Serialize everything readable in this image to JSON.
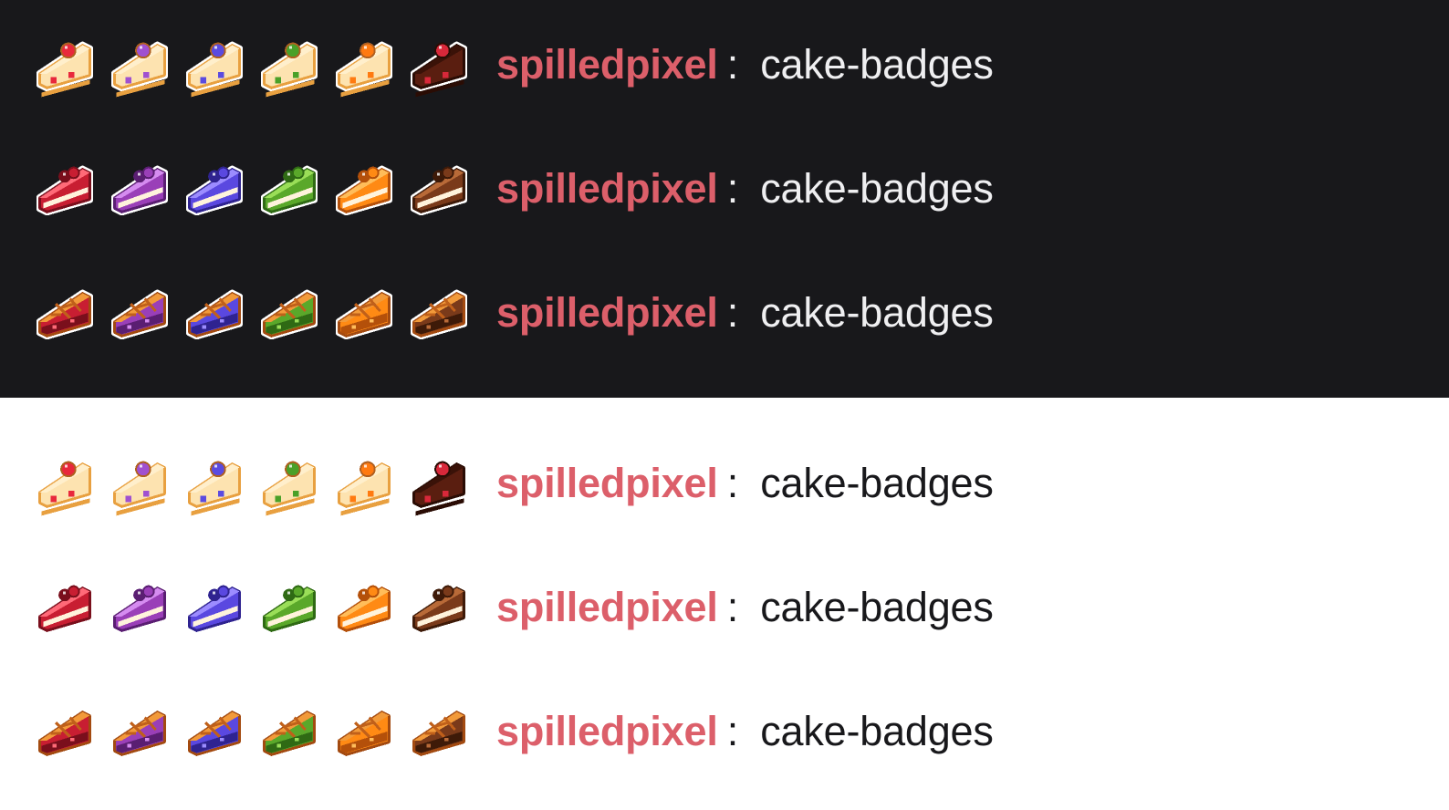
{
  "colors": {
    "dark_bg": "#18181b",
    "light_bg": "#ffffff",
    "username": "#dc5f6a"
  },
  "flavors": [
    {
      "name": "strawberry",
      "body": "#c81e32",
      "dark": "#7a0f1c",
      "light": "#ff6a78",
      "berry": "#e8283c"
    },
    {
      "name": "grape",
      "body": "#9a3fb8",
      "dark": "#5a1e72",
      "light": "#d58cf0",
      "berry": "#a050d0"
    },
    {
      "name": "blueberry",
      "body": "#5a48e0",
      "dark": "#2f2390",
      "light": "#9c8cff",
      "berry": "#5b4be0"
    },
    {
      "name": "matcha",
      "body": "#5aa82a",
      "dark": "#2f6a14",
      "light": "#9ade58",
      "berry": "#4aa028"
    },
    {
      "name": "orange",
      "body": "#ff8a14",
      "dark": "#b4500a",
      "light": "#ffbd5a",
      "berry": "#ff7a10"
    },
    {
      "name": "chocolate",
      "body": "#7a3a1a",
      "dark": "#3e1a08",
      "light": "#b86a38",
      "berry": "#d8283a"
    }
  ],
  "rows": [
    {
      "theme": "dark",
      "style": "cheesecake",
      "username": "spilledpixel",
      "separator": ":",
      "message": "cake-badges"
    },
    {
      "theme": "dark",
      "style": "layer",
      "username": "spilledpixel",
      "separator": ":",
      "message": "cake-badges"
    },
    {
      "theme": "dark",
      "style": "pie",
      "username": "spilledpixel",
      "separator": ":",
      "message": "cake-badges"
    },
    {
      "theme": "light",
      "style": "cheesecake",
      "username": "spilledpixel",
      "separator": ":",
      "message": "cake-badges"
    },
    {
      "theme": "light",
      "style": "layer",
      "username": "spilledpixel",
      "separator": ":",
      "message": "cake-badges"
    },
    {
      "theme": "light",
      "style": "pie",
      "username": "spilledpixel",
      "separator": ":",
      "message": "cake-badges"
    }
  ]
}
